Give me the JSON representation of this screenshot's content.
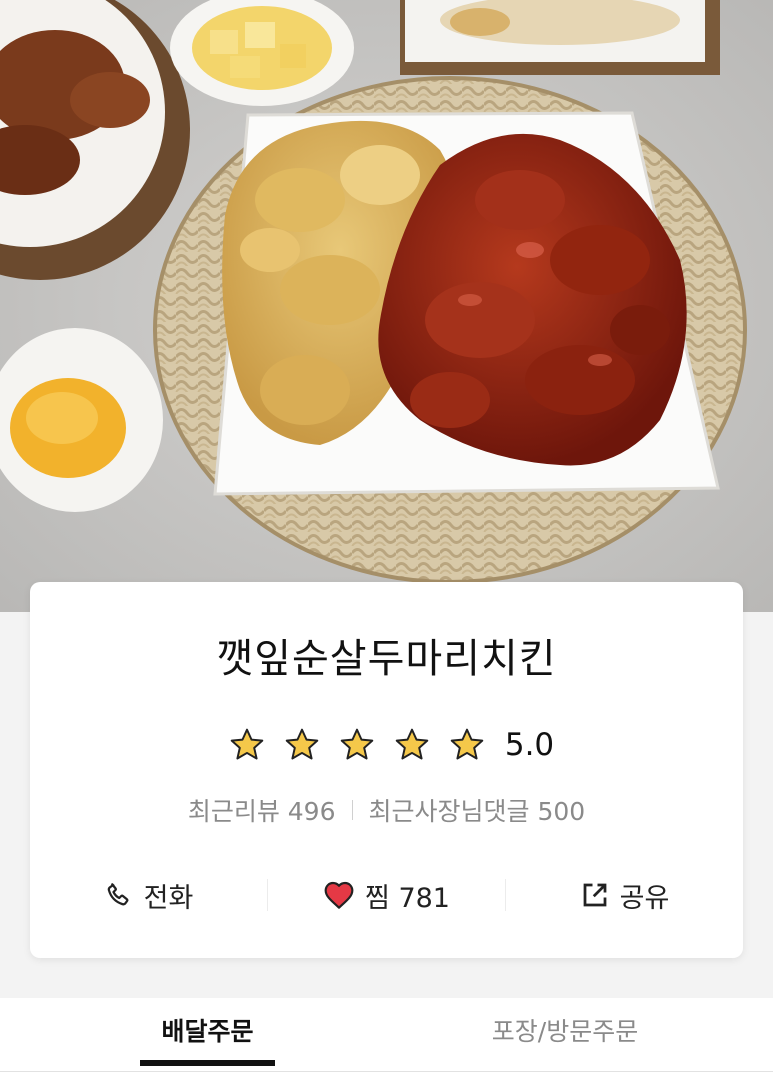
{
  "store": {
    "name": "깻잎순살두마리치킨",
    "rating": "5.0",
    "star_count": 5,
    "recent_reviews_label": "최근리뷰 496",
    "recent_owner_replies_label": "최근사장님댓글 500"
  },
  "actions": {
    "call": {
      "label": "전화",
      "icon": "phone-icon"
    },
    "like": {
      "label": "찜 781",
      "icon": "heart-icon"
    },
    "share": {
      "label": "공유",
      "icon": "share-icon"
    }
  },
  "tabs": [
    {
      "label": "배달주문",
      "active": true
    },
    {
      "label": "포장/방문주문",
      "active": false
    }
  ],
  "colors": {
    "star": "#f5c84a",
    "heart": "#e53945",
    "active_tab": "#111111",
    "muted_text": "#8a8a8a"
  }
}
